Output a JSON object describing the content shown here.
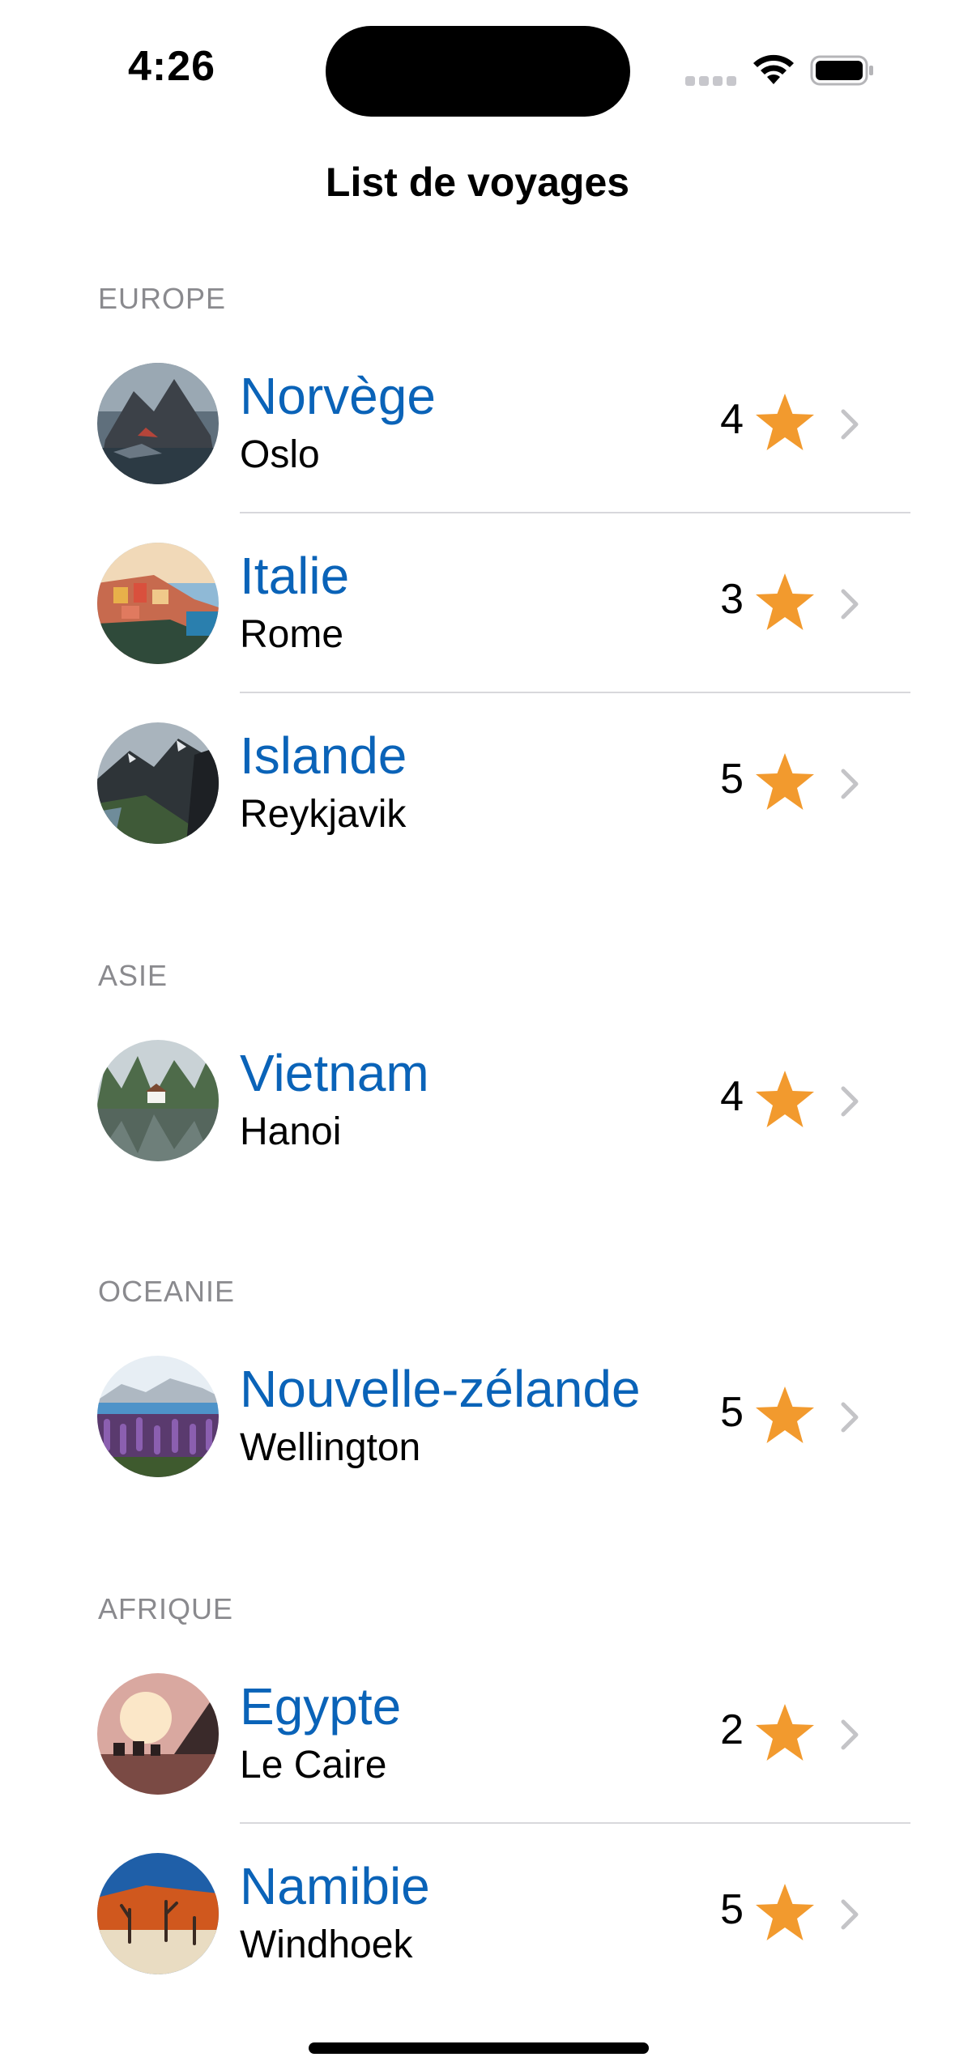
{
  "status_bar": {
    "time": "4:26"
  },
  "nav": {
    "title": "List de voyages"
  },
  "accent_color": "#0a63b8",
  "star_color": "#f29a2e",
  "sections": [
    {
      "header": "EUROPE",
      "items": [
        {
          "country": "Norvège",
          "city": "Oslo",
          "rating": "4"
        },
        {
          "country": "Italie",
          "city": "Rome",
          "rating": "3"
        },
        {
          "country": "Islande",
          "city": "Reykjavik",
          "rating": "5"
        }
      ]
    },
    {
      "header": "ASIE",
      "items": [
        {
          "country": "Vietnam",
          "city": "Hanoi",
          "rating": "4"
        }
      ]
    },
    {
      "header": "OCEANIE",
      "items": [
        {
          "country": "Nouvelle-zélande",
          "city": "Wellington",
          "rating": "5"
        }
      ]
    },
    {
      "header": "AFRIQUE",
      "items": [
        {
          "country": "Egypte",
          "city": "Le Caire",
          "rating": "2"
        },
        {
          "country": "Namibie",
          "city": "Windhoek",
          "rating": "5"
        }
      ]
    }
  ]
}
